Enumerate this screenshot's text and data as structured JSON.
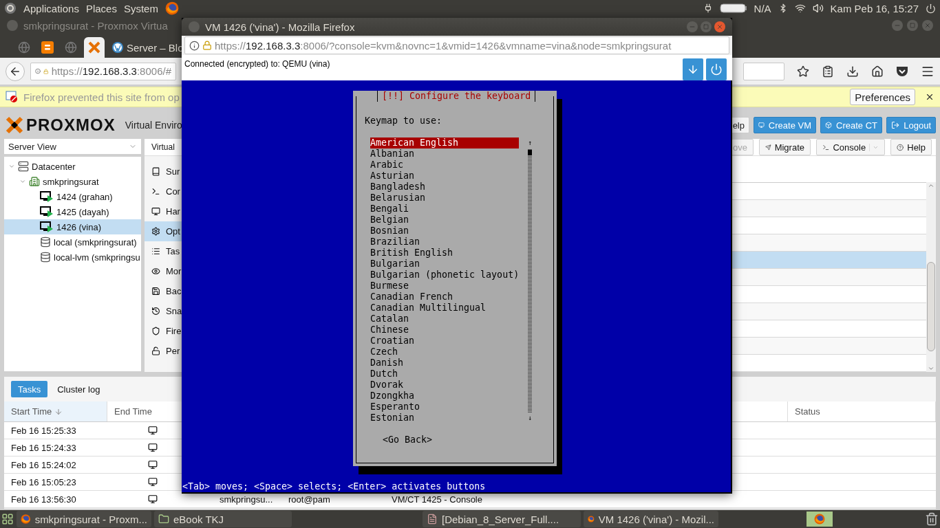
{
  "top_panel": {
    "menus": [
      "Applications",
      "Places",
      "System"
    ],
    "battery": "N/A",
    "clock": "Kam Peb 16, 15:27"
  },
  "back_window": {
    "title": "smkpringsurat - Proxmox Virtua",
    "tabs": [
      {
        "selected": false
      },
      {
        "selected": false
      },
      {
        "selected": false
      },
      {
        "selected": true
      },
      {
        "label": "Server – Blo",
        "selected": false
      }
    ],
    "url": {
      "scheme": "https://",
      "host": "192.168.3.3",
      "rest": ":8006/#"
    },
    "notification": {
      "text": "Firefox prevented this site from op",
      "button": "Preferences"
    }
  },
  "proxmox": {
    "brand": "PROXMOX",
    "subtitle": "Virtual Enviro",
    "header_buttons": [
      {
        "label": "elp",
        "kind": "plain"
      },
      {
        "label": "Create VM",
        "kind": "primary"
      },
      {
        "label": "Create CT",
        "kind": "primary"
      },
      {
        "label": "Logout",
        "kind": "primary"
      }
    ],
    "view_select": "Server View",
    "tree": [
      {
        "label": "Datacenter",
        "kind": "datacenter",
        "selected": false,
        "expanded": true,
        "children": [
          {
            "label": "smkpringsurat",
            "kind": "node",
            "selected": false,
            "expanded": true,
            "children": [
              {
                "label": "1424 (grahan)",
                "kind": "vm",
                "selected": false
              },
              {
                "label": "1425 (dayah)",
                "kind": "vm",
                "selected": false
              },
              {
                "label": "1426 (vina)",
                "kind": "vm",
                "selected": true
              },
              {
                "label": "local (smkpringsurat)",
                "kind": "storage",
                "selected": false
              },
              {
                "label": "local-lvm (smkpringsu",
                "kind": "storage",
                "selected": false
              }
            ]
          }
        ]
      }
    ],
    "panel_title": "Virtual",
    "vm_menu": [
      {
        "label": "Sur",
        "selected": false
      },
      {
        "label": "Cor",
        "selected": false
      },
      {
        "label": "Har",
        "selected": false
      },
      {
        "label": "Opt",
        "selected": true
      },
      {
        "label": "Tas",
        "selected": false
      },
      {
        "label": "Mor",
        "selected": false
      },
      {
        "label": "Bac",
        "selected": false
      },
      {
        "label": "Sna",
        "selected": false
      },
      {
        "label": "Fire",
        "selected": false
      },
      {
        "label": "Per",
        "selected": false
      }
    ],
    "toolbar": [
      {
        "label": "ove",
        "disabled": true,
        "dropdown": false
      },
      {
        "label": "Migrate",
        "disabled": false,
        "dropdown": false
      },
      {
        "label": "Console",
        "disabled": false,
        "dropdown": true
      },
      {
        "label": "Help",
        "disabled": false,
        "dropdown": false
      }
    ],
    "grid_rows": [
      {
        "selected": false
      },
      {
        "selected": false
      },
      {
        "selected": false
      },
      {
        "selected": false
      },
      {
        "selected": true
      },
      {
        "selected": false
      },
      {
        "selected": false
      },
      {
        "selected": false
      },
      {
        "selected": false
      },
      {
        "selected": false
      },
      {
        "selected": false
      }
    ],
    "tasks": {
      "tabs": [
        {
          "label": "Tasks",
          "selected": true
        },
        {
          "label": "Cluster log",
          "selected": false
        }
      ],
      "columns": [
        "Start Time",
        "End Time",
        "Status"
      ],
      "rows": [
        {
          "start": "Feb 16 15:25:33"
        },
        {
          "start": "Feb 16 15:24:33"
        },
        {
          "start": "Feb 16 15:24:02"
        },
        {
          "start": "Feb 16 15:05:23"
        },
        {
          "start": "Feb 16 13:56:30",
          "node": "smkpringsu...",
          "user": "root@pam",
          "description": "VM/CT 1425 - Console"
        }
      ]
    }
  },
  "popup": {
    "title": "VM 1426 ('vina') - Mozilla Firefox",
    "url": {
      "scheme": "https://",
      "host": "192.168.3.3",
      "rest": ":8006/?console=kvm&novnc=1&vmid=1426&vmname=vina&node=smkpringsurat"
    },
    "vnc_status": "Connected (encrypted) to: QEMU (vina)",
    "installer": {
      "title": "[!!] Configure the keyboard",
      "prompt": "Keymap to use:",
      "scroll_up": "↑",
      "scroll_down": "↓",
      "options": [
        {
          "label": "American English",
          "selected": true
        },
        {
          "label": "Albanian",
          "selected": false
        },
        {
          "label": "Arabic",
          "selected": false
        },
        {
          "label": "Asturian",
          "selected": false
        },
        {
          "label": "Bangladesh",
          "selected": false
        },
        {
          "label": "Belarusian",
          "selected": false
        },
        {
          "label": "Bengali",
          "selected": false
        },
        {
          "label": "Belgian",
          "selected": false
        },
        {
          "label": "Bosnian",
          "selected": false
        },
        {
          "label": "Brazilian",
          "selected": false
        },
        {
          "label": "British English",
          "selected": false
        },
        {
          "label": "Bulgarian",
          "selected": false
        },
        {
          "label": "Bulgarian (phonetic layout)",
          "selected": false
        },
        {
          "label": "Burmese",
          "selected": false
        },
        {
          "label": "Canadian French",
          "selected": false
        },
        {
          "label": "Canadian Multilingual",
          "selected": false
        },
        {
          "label": "Catalan",
          "selected": false
        },
        {
          "label": "Chinese",
          "selected": false
        },
        {
          "label": "Croatian",
          "selected": false
        },
        {
          "label": "Czech",
          "selected": false
        },
        {
          "label": "Danish",
          "selected": false
        },
        {
          "label": "Dutch",
          "selected": false
        },
        {
          "label": "Dvorak",
          "selected": false
        },
        {
          "label": "Dzongkha",
          "selected": false
        },
        {
          "label": "Esperanto",
          "selected": false
        },
        {
          "label": "Estonian",
          "selected": false
        }
      ],
      "back_button": "<Go Back>",
      "help_line": "<Tab> moves; <Space> selects; <Enter> activates buttons"
    }
  },
  "taskbar": [
    {
      "label": "smkpringsurat - Proxm..."
    },
    {
      "label": "eBook TKJ"
    },
    {
      "label": "[Debian_8_Server_Full...."
    },
    {
      "label": "VM 1426 ('vina') - Mozil..."
    }
  ]
}
